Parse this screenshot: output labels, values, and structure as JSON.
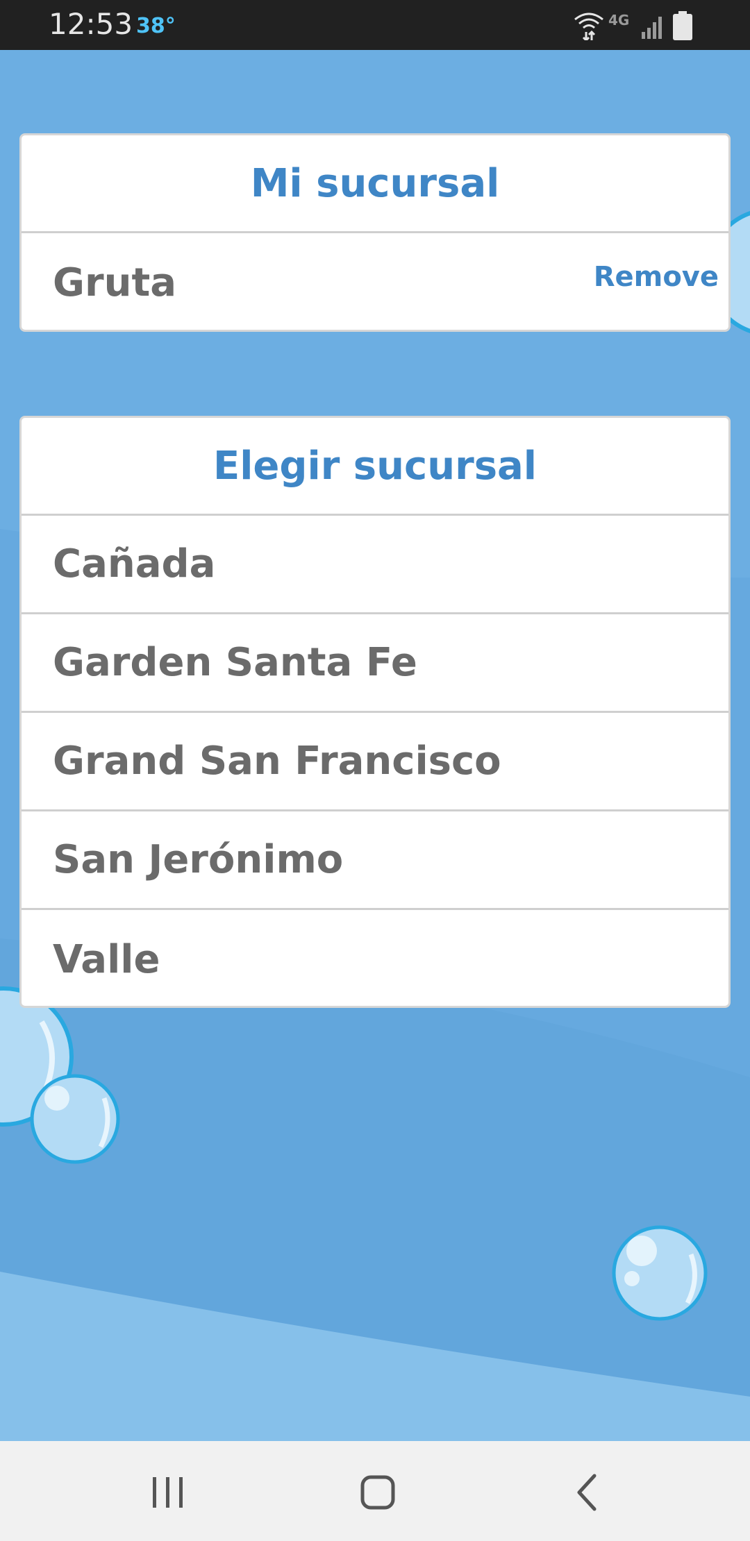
{
  "status_bar": {
    "time": "12:53",
    "temperature": "38°",
    "network": "4G",
    "icons": [
      "wifi-calling-icon",
      "network-4g-icon",
      "signal-icon",
      "battery-icon"
    ]
  },
  "my_branch": {
    "title": "Mi sucursal",
    "selected": "Gruta",
    "remove_label": "Remove"
  },
  "choose_branch": {
    "title": "Elegir sucursal",
    "items": [
      "Cañada",
      "Garden Santa Fe",
      "Grand San Francisco",
      "San Jerónimo",
      "Valle"
    ]
  },
  "nav_bar": {
    "buttons": [
      "recent-apps-icon",
      "home-icon",
      "back-icon"
    ]
  },
  "colors": {
    "background": "#6caee2",
    "accent": "#3f86c6",
    "text": "#6b6b6b",
    "card": "#ffffff"
  }
}
